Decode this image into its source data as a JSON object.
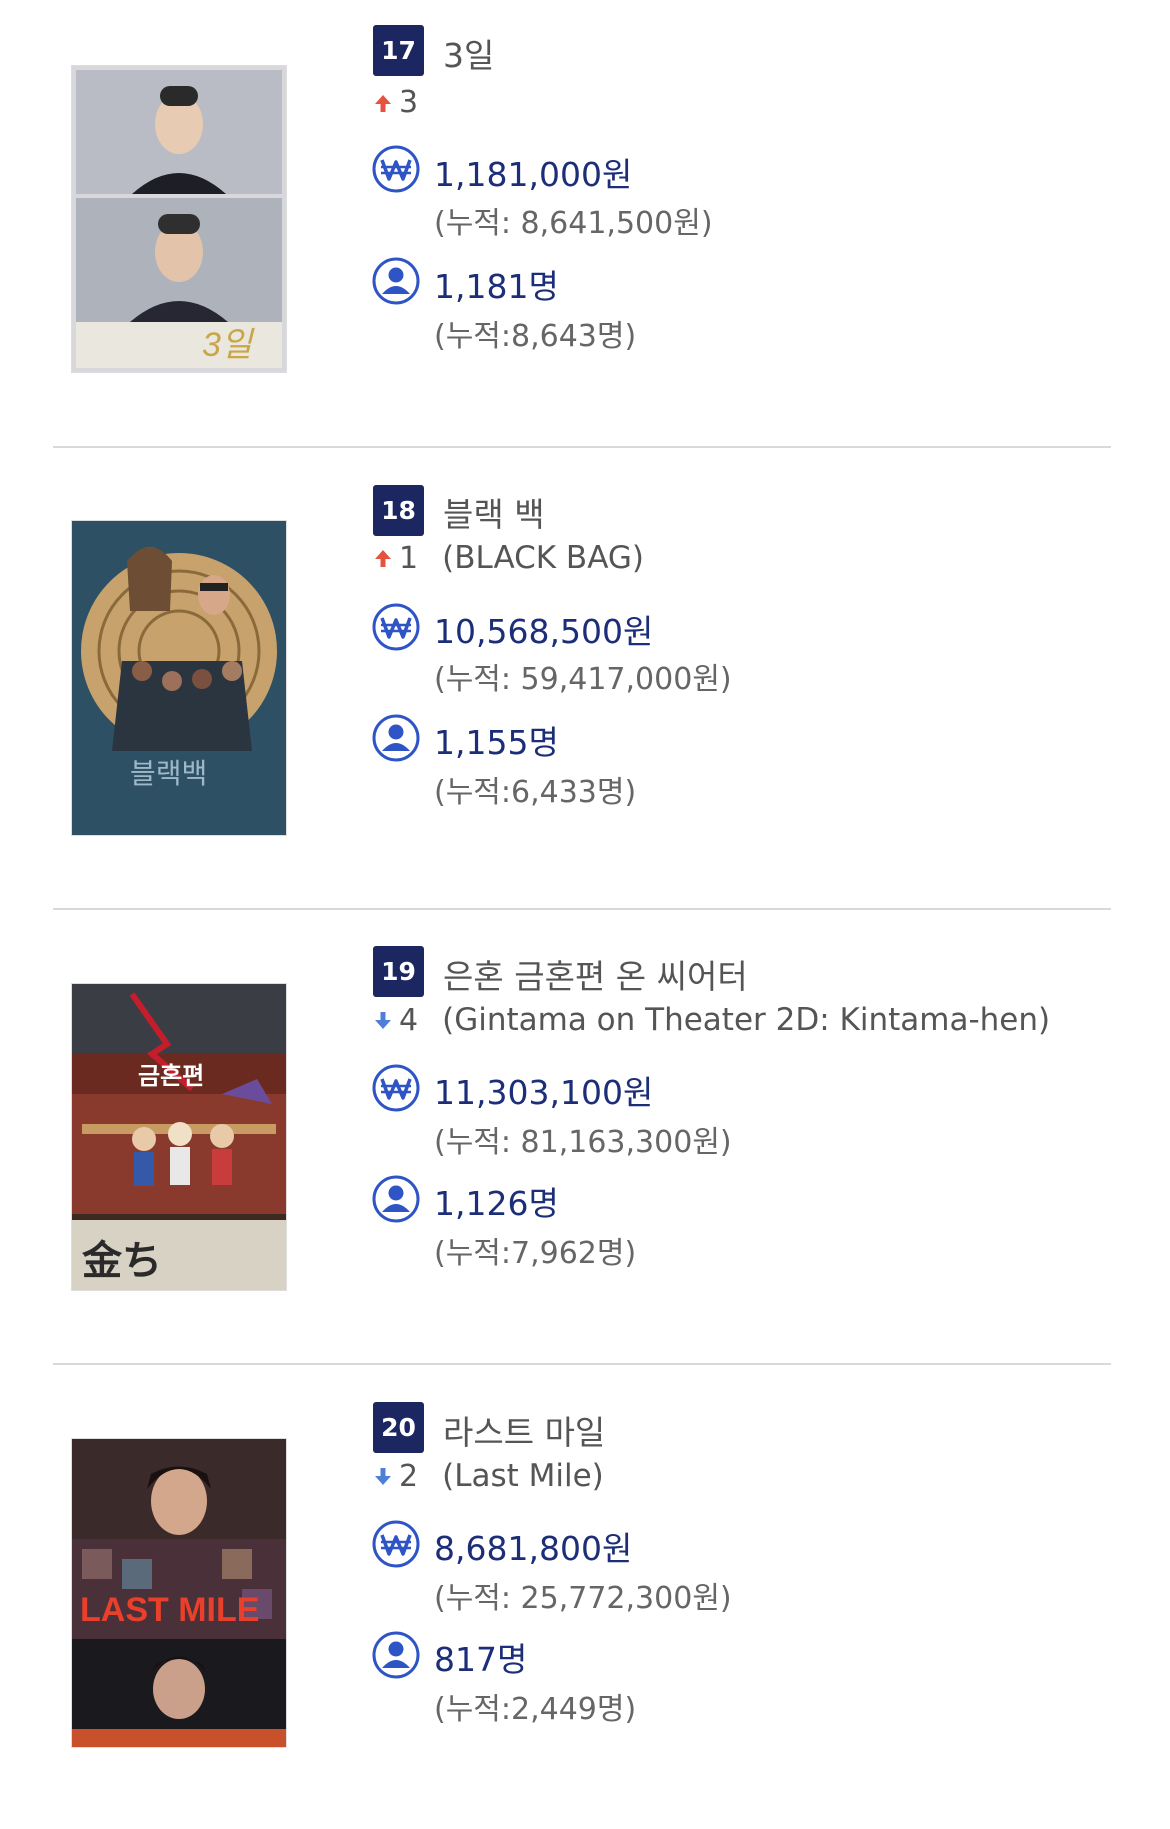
{
  "movies": [
    {
      "rank": "17",
      "title": "3일",
      "change_direction": "up",
      "change": "3",
      "original_title": "",
      "sales": "1,181,000원",
      "sales_cumulative": "(누적: 8,641,500원)",
      "audience": "1,181명",
      "audience_cumulative": "(누적:8,643명)",
      "poster_text": "3일"
    },
    {
      "rank": "18",
      "title": "블랙 백",
      "change_direction": "up",
      "change": "1",
      "original_title": "(BLACK BAG)",
      "sales": "10,568,500원",
      "sales_cumulative": "(누적: 59,417,000원)",
      "audience": "1,155명",
      "audience_cumulative": "(누적:6,433명)",
      "poster_text": "블랙백"
    },
    {
      "rank": "19",
      "title": "은혼 금혼편 온 씨어터",
      "change_direction": "down",
      "change": "4",
      "original_title": "(Gintama on Theater 2D: Kintama-hen)",
      "sales": "11,303,100원",
      "sales_cumulative": "(누적: 81,163,300원)",
      "audience": "1,126명",
      "audience_cumulative": "(누적:7,962명)",
      "poster_text": "금혼편"
    },
    {
      "rank": "20",
      "title": "라스트 마일",
      "change_direction": "down",
      "change": "2",
      "original_title": "(Last Mile)",
      "sales": "8,681,800원",
      "sales_cumulative": "(누적: 25,772,300원)",
      "audience": "817명",
      "audience_cumulative": "(누적:2,449명)",
      "poster_text": "LAST MILE"
    }
  ],
  "colors": {
    "rank_badge": "#1c2660",
    "value_text": "#1c2e78",
    "icon": "#2e54c6",
    "arrow_up": "#e5533f",
    "arrow_down": "#4f80d9",
    "divider": "#d9d9d9"
  },
  "icons": {
    "sales": "won-icon",
    "audience": "person-icon",
    "up": "arrow-up-icon",
    "down": "arrow-down-icon"
  }
}
